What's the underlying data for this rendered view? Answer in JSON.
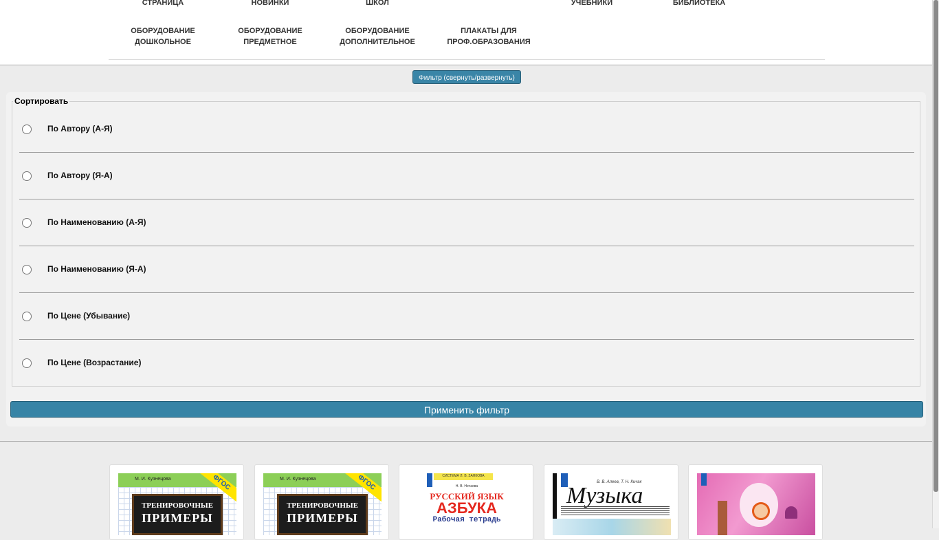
{
  "nav": {
    "row1": [
      "СТРАНИЦА",
      "НОВИНКИ",
      "ШКОЛ",
      "УЧЕБНИКИ",
      "БИБЛИОТЕКА"
    ],
    "row2": [
      {
        "line1": "ОБОРУДОВАНИЕ",
        "line2": "ДОШКОЛЬНОЕ"
      },
      {
        "line1": "ОБОРУДОВАНИЕ",
        "line2": "ПРЕДМЕТНОЕ"
      },
      {
        "line1": "ОБОРУДОВАНИЕ",
        "line2": "ДОПОЛНИТЕЛЬНОЕ"
      },
      {
        "line1": "ПЛАКАТЫ ДЛЯ",
        "line2": "ПРОФ.ОБРАЗОВАНИЯ"
      }
    ]
  },
  "filter": {
    "toggle_label": "Фильтр (свернуть/развернуть)",
    "sort_legend": "Сортировать",
    "options": [
      "По Автору (А-Я)",
      "По Автору (Я-А)",
      "По Наименованию (А-Я)",
      "По Наименованию (Я-А)",
      "По Цене (Убывание)",
      "По Цене (Возрастание)"
    ],
    "apply_label": "Применить фильтр"
  },
  "products": [
    {
      "author": "М. И. Кузнецова",
      "badge": "ФГОС",
      "title1": "ТРЕНИРОВОЧНЫЕ",
      "title2": "ПРИМЕРЫ"
    },
    {
      "author": "М. И. Кузнецова",
      "badge": "ФГОС",
      "title1": "ТРЕНИРОВОЧНЫЕ",
      "title2": "ПРИМЕРЫ"
    },
    {
      "series": "СИСТЕМА Л. В. ЗАНКОВА",
      "author": "Н. В. Нечаева",
      "title1": "РУССКИЙ ЯЗЫК",
      "title2": "АЗБУКА",
      "title3": "Рабочая тетрадь"
    },
    {
      "author": "В. В. Алеев, Т. Н. Кичак",
      "title": "Музыка"
    },
    {
      "title": ""
    }
  ],
  "colors": {
    "accent": "#3784a6",
    "nav_bg": "#ffffff",
    "page_bg": "#ececec"
  }
}
